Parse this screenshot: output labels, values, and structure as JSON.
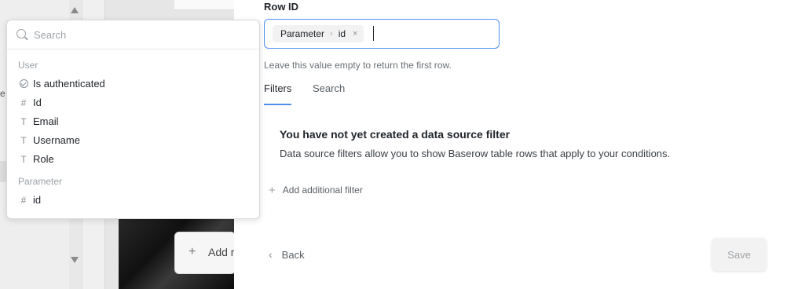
{
  "background": {
    "sidebar_edge_text": "e",
    "card_label": "Add r",
    "card_icon": "plus-icon"
  },
  "dropdown": {
    "search_placeholder": "Search",
    "groups": [
      {
        "title": "User",
        "items": [
          {
            "label": "Is authenticated",
            "icon": "check-circle-icon"
          },
          {
            "label": "Id",
            "icon": "hash-icon"
          },
          {
            "label": "Email",
            "icon": "text-icon"
          },
          {
            "label": "Username",
            "icon": "text-icon"
          },
          {
            "label": "Role",
            "icon": "text-icon"
          }
        ]
      },
      {
        "title": "Parameter",
        "items": [
          {
            "label": "id",
            "icon": "hash-icon"
          }
        ]
      }
    ]
  },
  "form": {
    "row_id_label": "Row ID",
    "chip": {
      "part1": "Parameter",
      "separator": "›",
      "part2": "id",
      "remove": "×"
    },
    "help_text": "Leave this value empty to return the first row.",
    "tabs": [
      {
        "label": "Filters",
        "active": true
      },
      {
        "label": "Search",
        "active": false
      }
    ],
    "empty_title": "You have not yet created a data source filter",
    "empty_description": "Data source filters allow you to show Baserow table rows that apply to your conditions.",
    "add_filter_label": "Add additional filter"
  },
  "footer": {
    "back_label": "Back",
    "save_label": "Save"
  },
  "colors": {
    "accent": "#5190ef",
    "text": "#1f2328",
    "muted": "#6b7075"
  }
}
